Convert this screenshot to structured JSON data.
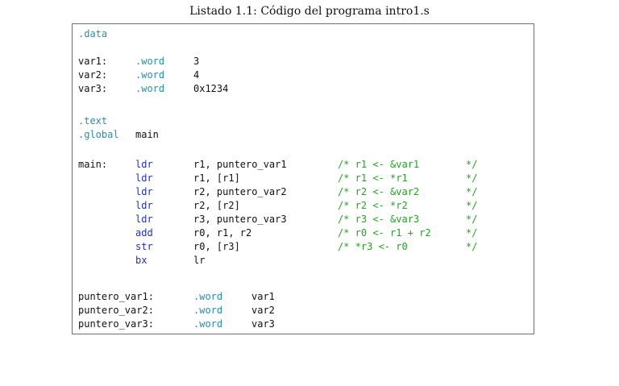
{
  "caption": "Listado 1.1: Código del programa intro1.s",
  "code": {
    "data_directive": ".data",
    "var1": {
      "label": "var1:",
      "dir": ".word",
      "val": "3"
    },
    "var2": {
      "label": "var2:",
      "dir": ".word",
      "val": "4"
    },
    "var3": {
      "label": "var3:",
      "dir": ".word",
      "val": "0x1234"
    },
    "text_directive": ".text",
    "global_directive": ".global",
    "global_symbol": "main",
    "main_label": "main:",
    "instructions": [
      {
        "op": "ldr",
        "args": "r1, puntero_var1",
        "comment": "/* r1 <- &var1",
        "close": "*/"
      },
      {
        "op": "ldr",
        "args": "r1, [r1]",
        "comment": "/* r1 <- *r1",
        "close": "*/"
      },
      {
        "op": "ldr",
        "args": "r2, puntero_var2",
        "comment": "/* r2 <- &var2",
        "close": "*/"
      },
      {
        "op": "ldr",
        "args": "r2, [r2]",
        "comment": "/* r2 <- *r2",
        "close": "*/"
      },
      {
        "op": "ldr",
        "args": "r3, puntero_var3",
        "comment": "/* r3 <- &var3",
        "close": "*/"
      },
      {
        "op": "add",
        "args": "r0, r1, r2",
        "comment": "/* r0 <- r1 + r2",
        "close": "*/"
      },
      {
        "op": "str",
        "args": "r0, [r3]",
        "comment": "/* *r3 <- r0",
        "close": "*/"
      },
      {
        "op": "bx",
        "args": "lr",
        "comment": "",
        "close": ""
      }
    ],
    "pointers": [
      {
        "label": "puntero_var1:",
        "dir": ".word",
        "val": "var1"
      },
      {
        "label": "puntero_var2:",
        "dir": ".word",
        "val": "var2"
      },
      {
        "label": "puntero_var3:",
        "dir": ".word",
        "val": "var3"
      }
    ]
  }
}
